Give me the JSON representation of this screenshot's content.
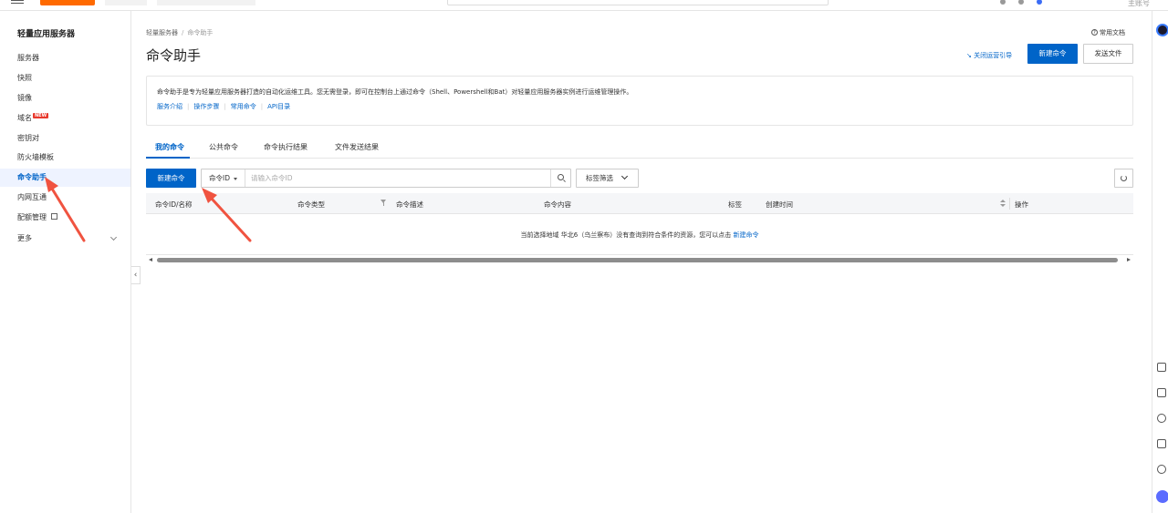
{
  "topbar": {
    "account_label": "主账号"
  },
  "sidebar": {
    "title": "轻量应用服务器",
    "items": [
      {
        "label": "服务器"
      },
      {
        "label": "快照"
      },
      {
        "label": "镜像"
      },
      {
        "label": "域名",
        "badge": "NEW"
      },
      {
        "label": "密钥对"
      },
      {
        "label": "防火墙模板"
      },
      {
        "label": "命令助手",
        "active": true
      },
      {
        "label": "内网互通"
      },
      {
        "label": "配额管理"
      },
      {
        "label": "更多"
      }
    ]
  },
  "header": {
    "breadcrumb": [
      "轻量服务器",
      "命令助手"
    ],
    "breadcrumb_sep": "/",
    "title": "命令助手",
    "help_label": "常用文档",
    "guide_label": "关闭运营引导",
    "new_command_label": "新建命令",
    "send_file_label": "发送文件"
  },
  "intro": {
    "text": "命令助手是专为轻量应用服务器打造的自动化运维工具。您无需登录，即可在控制台上通过命令（Shell、Powershell和Bat）对轻量应用服务器实例进行运维管理操作。",
    "links": [
      "服务介绍",
      "操作步骤",
      "常用命令",
      "API目录"
    ]
  },
  "tabs": [
    "我的命令",
    "公共命令",
    "命令执行结果",
    "文件发送结果"
  ],
  "active_tab": "我的命令",
  "toolbar": {
    "new_command_label": "新建命令",
    "filter_select": "命令ID",
    "search_placeholder": "请输入命令ID",
    "tag_filter_label": "标签筛选"
  },
  "table": {
    "columns": [
      "命令ID/名称",
      "命令类型",
      "命令描述",
      "命令内容",
      "标签",
      "创建时间",
      "操作"
    ],
    "empty_text": "当前选择地域 华北6（乌兰察布）没有查询到符合条件的资源，您可以点击",
    "empty_link": "新建命令"
  },
  "colors": {
    "primary": "#0064c8",
    "annotation_arrow": "#f05340",
    "active_bg": "#eef3ff",
    "new_badge": "#e8382c"
  }
}
